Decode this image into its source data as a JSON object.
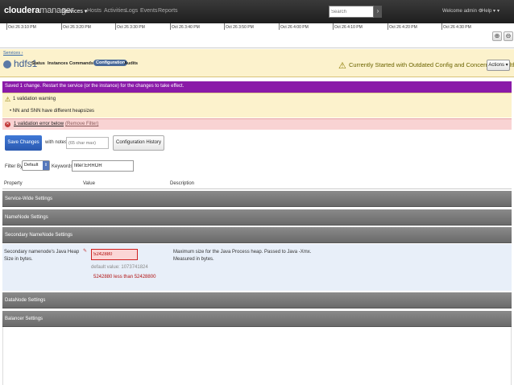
{
  "nav": {
    "logo_brand": "cloudera",
    "logo_product": "manager",
    "services": "Services",
    "hosts": "Hosts",
    "activities": "Activities",
    "logs": "Logs",
    "events": "Events",
    "reports": "Reports",
    "search_placeholder": "Search",
    "welcome": "Welcome admin",
    "help": "Help"
  },
  "timeline": {
    "labels": [
      "Oct 26 3:10 PM",
      "Oct 26 3:20 PM",
      "Oct 26 3:30 PM",
      "Oct 26 3:40 PM",
      "Oct 26 3:50 PM",
      "Oct 26 4:00 PM",
      "Oct 26 4:10 PM",
      "Oct 26 4:20 PM",
      "Oct 26 4:30 PM"
    ]
  },
  "service": {
    "breadcrumb": "Services",
    "name": "hdfs1",
    "tabs": [
      "Status",
      "Instances",
      "Commands",
      "Configuration",
      "Audits"
    ],
    "health": "Currently Started with Outdated Config and Concerning Health",
    "actions": "Actions"
  },
  "alerts": {
    "restart": "Saved 1 change. Restart the service (or the instance) for the changes to take effect.",
    "warning_title": "1 validation warning",
    "warning_item": "NN and SNN have different heapsizes",
    "error_title": "1 validation error below",
    "remove_filter": "(Remove Filter)"
  },
  "save": {
    "button": "Save Changes",
    "with_notes": "with notes",
    "notes_placeholder": "(65 char max)",
    "history": "Configuration History"
  },
  "filter": {
    "label": "Filter By",
    "selected": "Default",
    "keywords_label": "Keywords",
    "keywords_value": "filter:ERROR"
  },
  "table": {
    "headers": {
      "property": "Property",
      "value": "Value",
      "description": "Description"
    },
    "groups": [
      "Service-Wide Settings",
      "NameNode Settings",
      "Secondary NameNode Settings",
      "DataNode Settings",
      "Balancer Settings"
    ],
    "row": {
      "property": "Secondary namenode's Java Heap Size in bytes.",
      "value": "5242880",
      "default": "default value: 1073741824",
      "error": "5242880 less than 52428800",
      "description": "Maximum size for the Java Process heap. Passed to Java -Xmx. Measured in bytes."
    }
  }
}
